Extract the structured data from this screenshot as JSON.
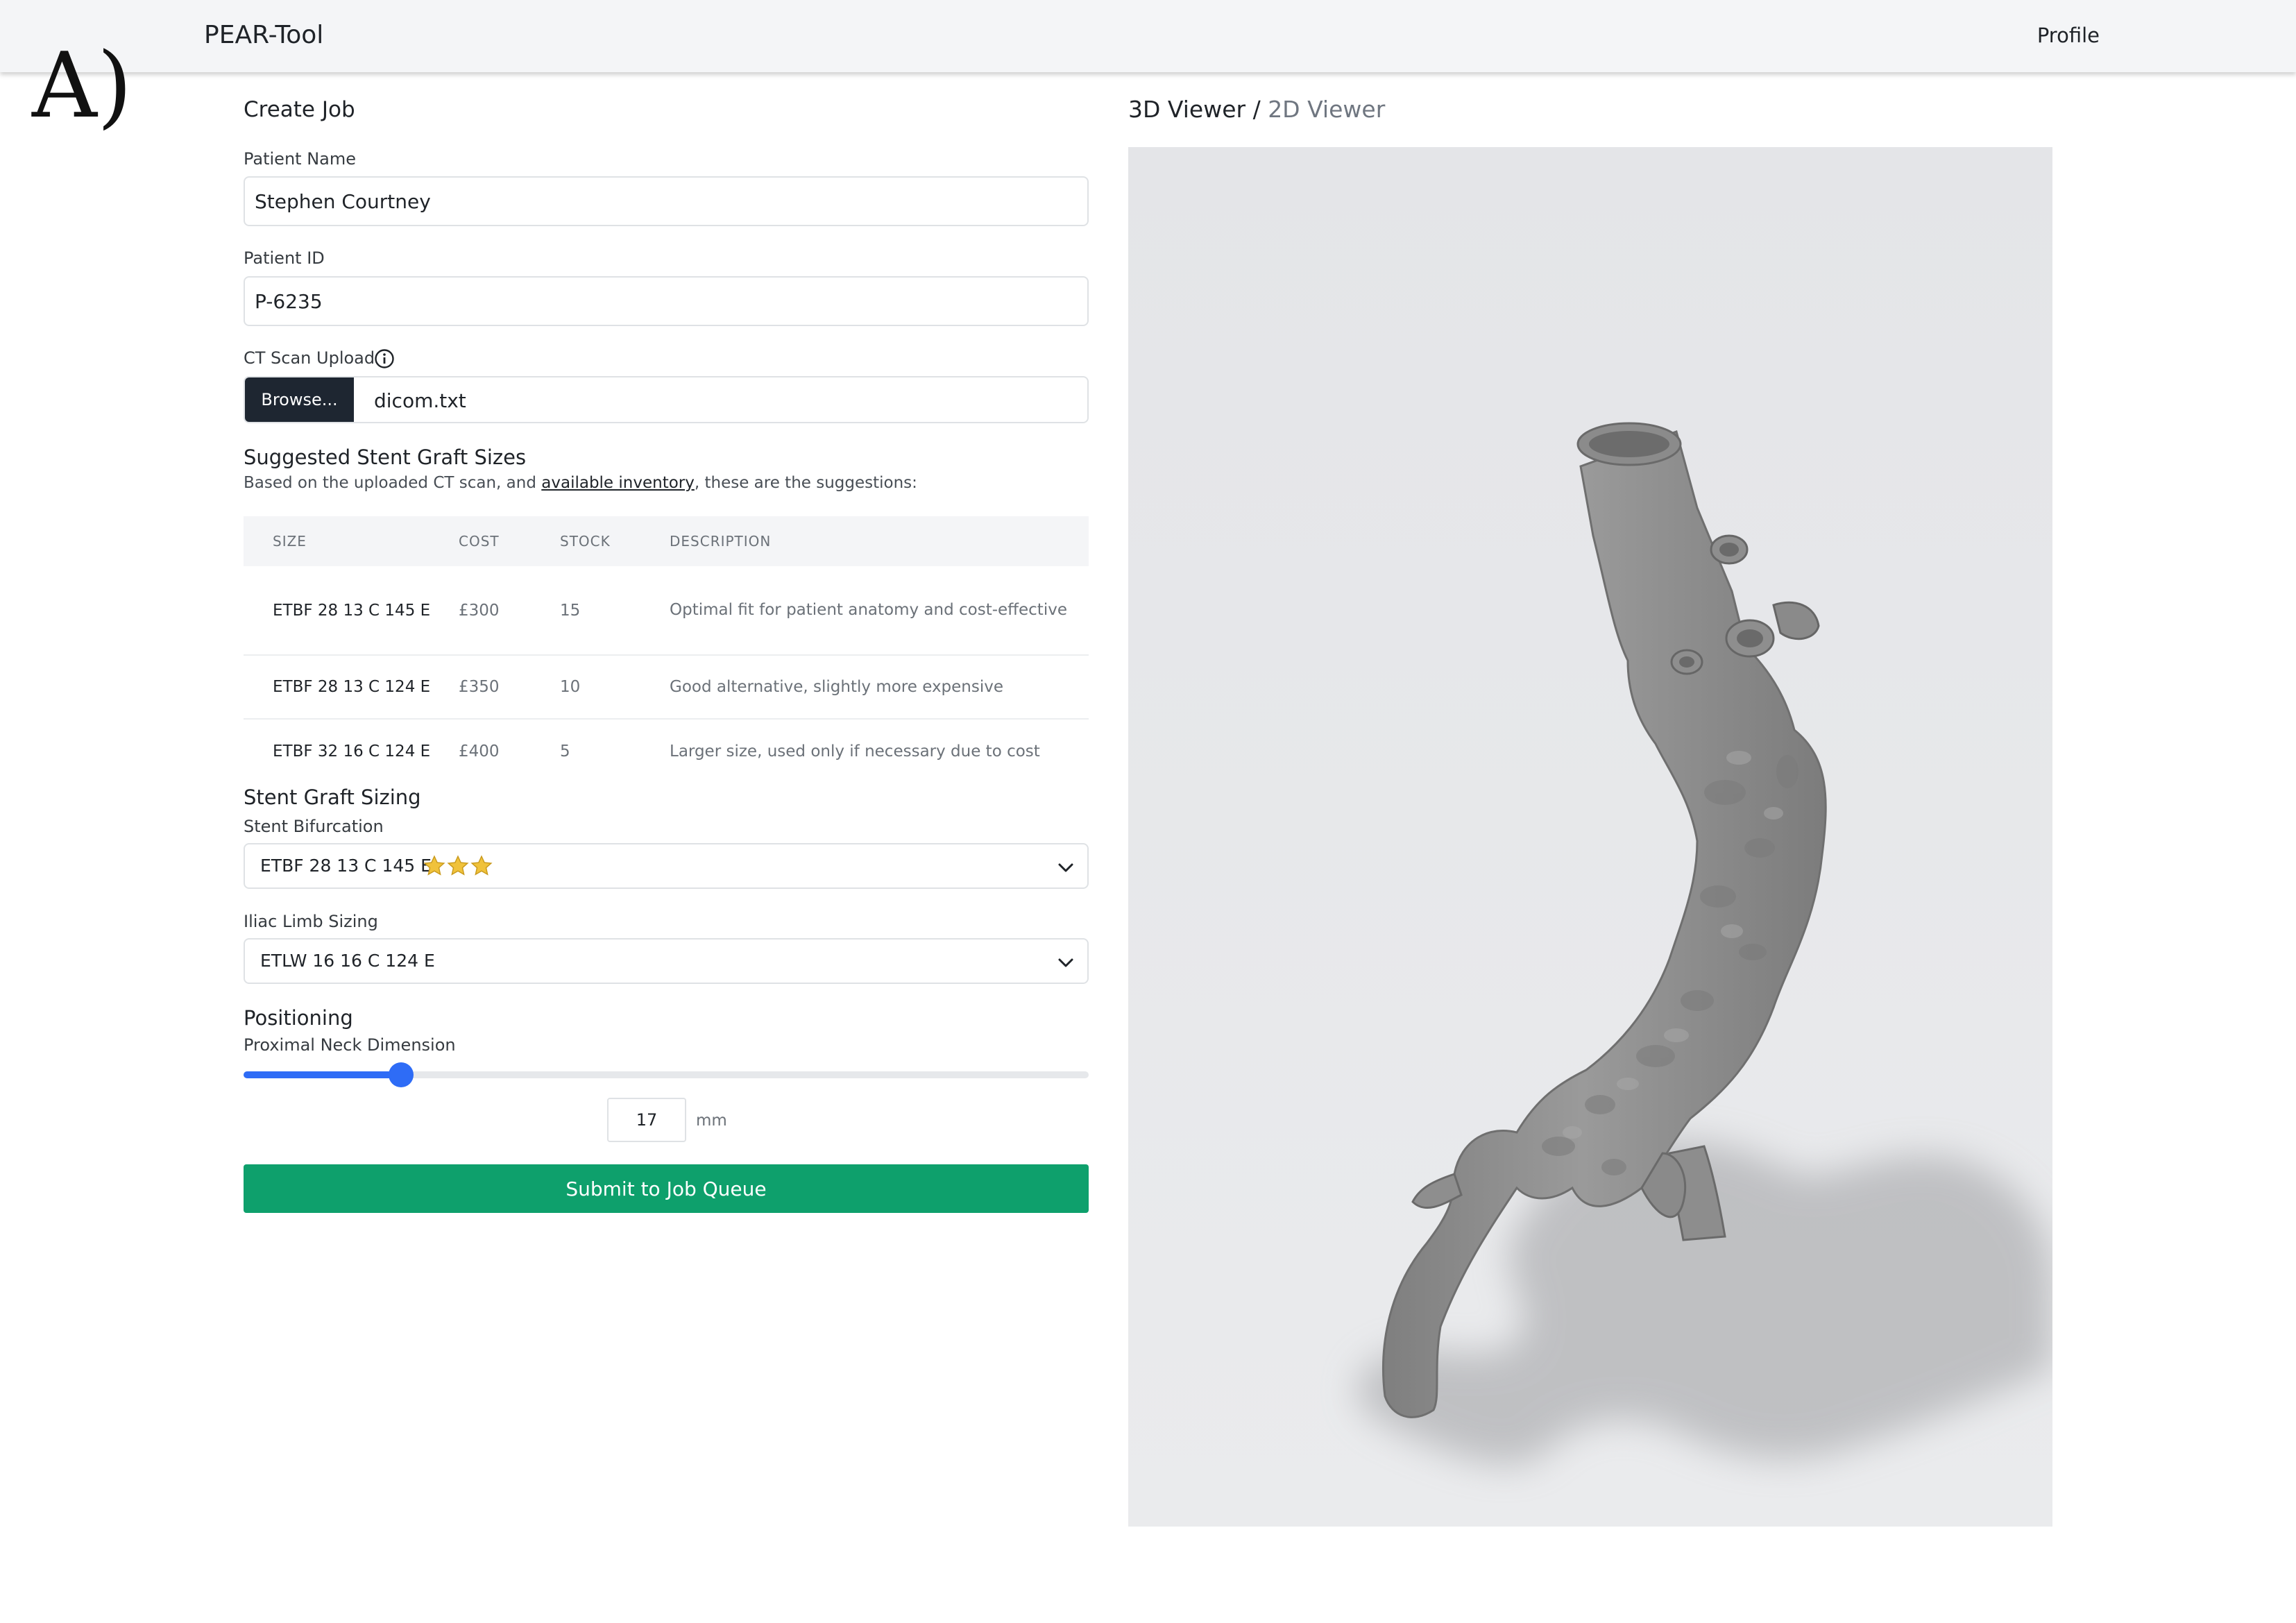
{
  "panel_tag": "A)",
  "navbar": {
    "brand": "PEAR-Tool",
    "profile": "Profile"
  },
  "form": {
    "title": "Create Job",
    "patient_name": {
      "label": "Patient Name",
      "value": "Stephen Courtney"
    },
    "patient_id": {
      "label": "Patient ID",
      "value": "P-6235"
    },
    "ct_upload": {
      "label": "CT Scan Upload",
      "browse_label": "Browse...",
      "file_name": "dicom.txt",
      "icon": "info-icon"
    },
    "suggested": {
      "title": "Suggested Stent Graft Sizes",
      "desc_prefix": "Based on the uploaded CT scan, and ",
      "desc_link": "available inventory",
      "desc_suffix": ", these are the suggestions:",
      "columns": [
        "SIZE",
        "COST",
        "STOCK",
        "DESCRIPTION"
      ],
      "rows": [
        {
          "size": "ETBF 28 13 C 145 E",
          "cost": "£300",
          "stock": "15",
          "description": "Optimal fit for patient anatomy and cost-effective"
        },
        {
          "size": "ETBF 28 13 C 124 E",
          "cost": "£350",
          "stock": "10",
          "description": "Good alternative, slightly more expensive"
        },
        {
          "size": "ETBF 32 16 C 124 E",
          "cost": "£400",
          "stock": "5",
          "description": "Larger size, used only if necessary due to cost"
        }
      ]
    },
    "sizing": {
      "title": "Stent Graft Sizing",
      "bifurcation": {
        "label": "Stent Bifurcation",
        "value": "ETBF 28 13 C 145 E",
        "rating": 3,
        "star_color": "#f0c23b"
      },
      "iliac": {
        "label": "Iliac Limb Sizing",
        "value": "ETLW 16 16 C 124 E"
      }
    },
    "positioning": {
      "title": "Positioning",
      "label": "Proximal Neck Dimension",
      "value": "17",
      "unit": "mm",
      "slider_fraction": 0.186,
      "accent": "#2e6cf6"
    },
    "submit_label": "Submit to Job Queue",
    "submit_color": "#0ea06c"
  },
  "viewer": {
    "tab_3d": "3D Viewer",
    "separator": " / ",
    "tab_2d": "2D Viewer"
  }
}
